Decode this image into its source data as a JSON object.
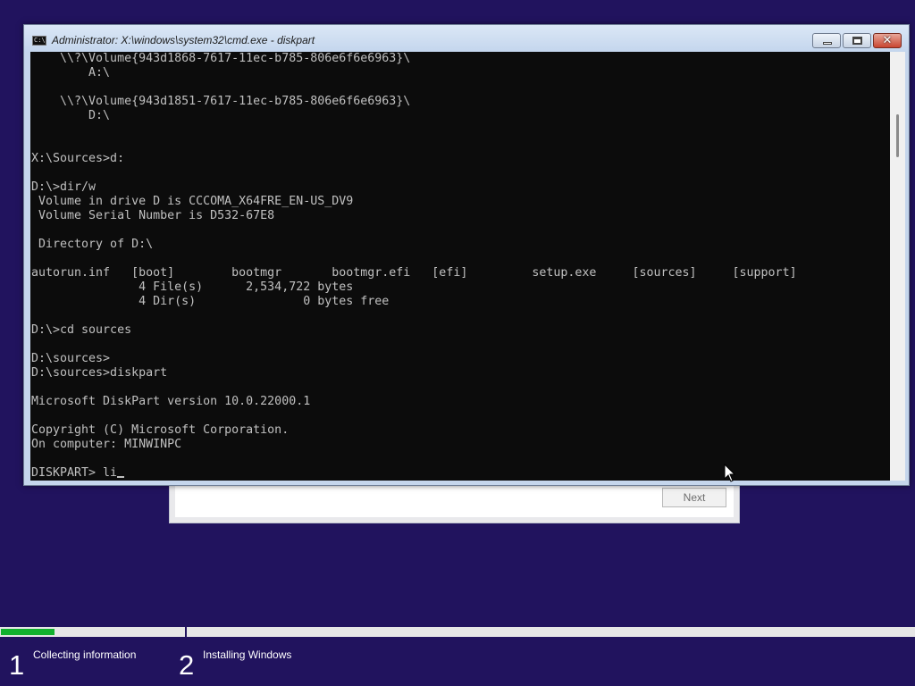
{
  "setup": {
    "next_label": "Next"
  },
  "cmd": {
    "title": "Administrator: X:\\windows\\system32\\cmd.exe - diskpart",
    "icon_label": "C:\\",
    "console_lines": [
      "    \\\\?\\Volume{943d1868-7617-11ec-b785-806e6f6e6963}\\",
      "        A:\\",
      "",
      "    \\\\?\\Volume{943d1851-7617-11ec-b785-806e6f6e6963}\\",
      "        D:\\",
      "",
      "",
      "X:\\Sources>d:",
      "",
      "D:\\>dir/w",
      " Volume in drive D is CCCOMA_X64FRE_EN-US_DV9",
      " Volume Serial Number is D532-67E8",
      "",
      " Directory of D:\\",
      "",
      "autorun.inf   [boot]        bootmgr       bootmgr.efi   [efi]         setup.exe     [sources]     [support]",
      "               4 File(s)      2,534,722 bytes",
      "               4 Dir(s)               0 bytes free",
      "",
      "D:\\>cd sources",
      "",
      "D:\\sources>",
      "D:\\sources>diskpart",
      "",
      "Microsoft DiskPart version 10.0.22000.1",
      "",
      "Copyright (C) Microsoft Corporation.",
      "On computer: MINWINPC",
      ""
    ],
    "prompt_line": "DISKPART> li"
  },
  "progress": {
    "step1_fraction": 0.29,
    "fill_color": "#12b12e",
    "steps": [
      {
        "number": "1",
        "label": "Collecting information"
      },
      {
        "number": "2",
        "label": "Installing Windows"
      }
    ]
  },
  "colors": {
    "desktop_background": "#21135e",
    "console_background": "#0c0c0c",
    "console_text": "#c0c0c0"
  },
  "icons": {
    "cmd_icon": "cmd-icon",
    "minimize": "minimize-icon",
    "maximize": "maximize-icon",
    "close": "close-icon",
    "pointer": "mouse-pointer-icon"
  }
}
